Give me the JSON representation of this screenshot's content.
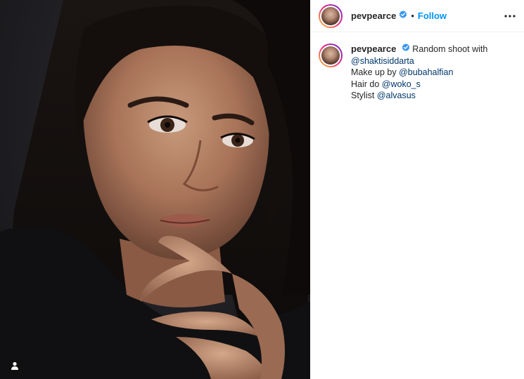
{
  "post": {
    "author": {
      "username": "pevpearce",
      "verified_icon": "verified-badge-icon",
      "follow_label": "Follow",
      "separator": "•"
    },
    "more_icon": "more-options-icon",
    "caption": {
      "username": "pevpearce",
      "line1_text": "Random shoot with",
      "line2_mention": "@shaktisiddarta",
      "line3_text": "Make up by",
      "line3_mention": "@bubahalfian",
      "line4_text": "Hair do",
      "line4_mention": "@woko_s",
      "line5_text": "Stylist",
      "line5_mention": "@alvasus"
    },
    "photo": {
      "tag_icon": "user-tag-icon"
    }
  },
  "colors": {
    "follow": "#0095f6",
    "verified": "#3897f0",
    "mention": "#00376b"
  }
}
